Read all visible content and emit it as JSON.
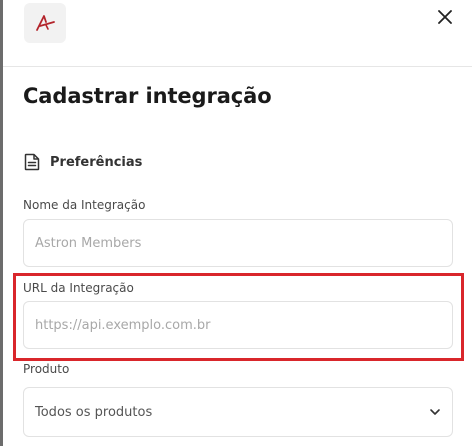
{
  "header": {
    "logo_icon": "astron-logo-icon",
    "close_icon": "close-icon"
  },
  "title": "Cadastrar integração",
  "section": {
    "icon": "document-icon",
    "label": "Preferências"
  },
  "fields": {
    "name": {
      "label": "Nome da Integração",
      "placeholder": "Astron Members",
      "value": ""
    },
    "url": {
      "label": "URL da Integração",
      "placeholder": "https://api.exemplo.com.br",
      "value": ""
    },
    "product": {
      "label": "Produto",
      "selected": "Todos os produtos",
      "icon": "chevron-down-icon"
    }
  },
  "colors": {
    "highlight": "#d9262b",
    "logo_accent": "#b3242b"
  }
}
